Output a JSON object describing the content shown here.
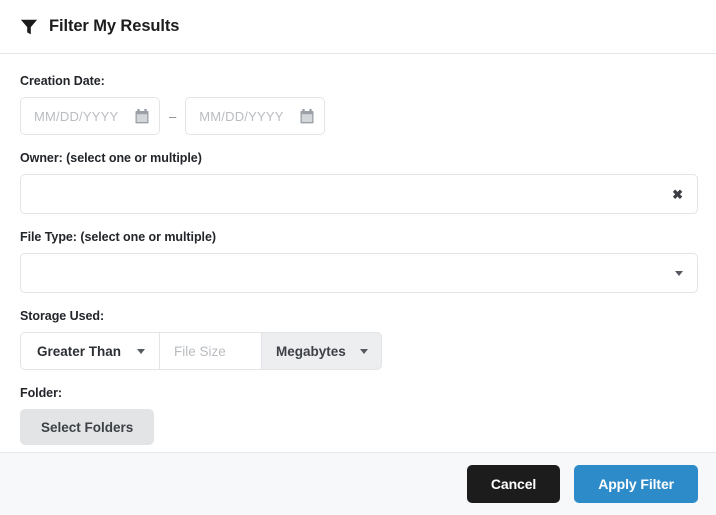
{
  "header": {
    "icon": "funnel-icon",
    "title": "Filter My Results"
  },
  "form": {
    "creation_date": {
      "label": "Creation Date:",
      "from_placeholder": "MM/DD/YYYY",
      "to_placeholder": "MM/DD/YYYY",
      "separator": "–",
      "from_value": "",
      "to_value": "",
      "icon": "calendar-icon"
    },
    "owner": {
      "label": "Owner: (select one or multiple)",
      "value": "",
      "placeholder": "",
      "clear_icon": "✖"
    },
    "file_type": {
      "label": "File Type: (select one or multiple)",
      "value": "",
      "placeholder": "",
      "dropdown_icon": "chevron-down-icon"
    },
    "storage_used": {
      "label": "Storage Used:",
      "operator": "Greater Than",
      "size_placeholder": "File Size",
      "size_value": "",
      "unit": "Megabytes"
    },
    "folder": {
      "label": "Folder:",
      "button_label": "Select Folders"
    }
  },
  "footer": {
    "cancel_label": "Cancel",
    "apply_label": "Apply Filter"
  },
  "colors": {
    "accent_blue": "#2e8bc9",
    "cancel_black": "#1c1c1c",
    "footer_bg": "#f7f8fa",
    "border": "#e2e4e7",
    "muted_text": "#b9bcc0",
    "gray_button": "#e2e4e6"
  }
}
